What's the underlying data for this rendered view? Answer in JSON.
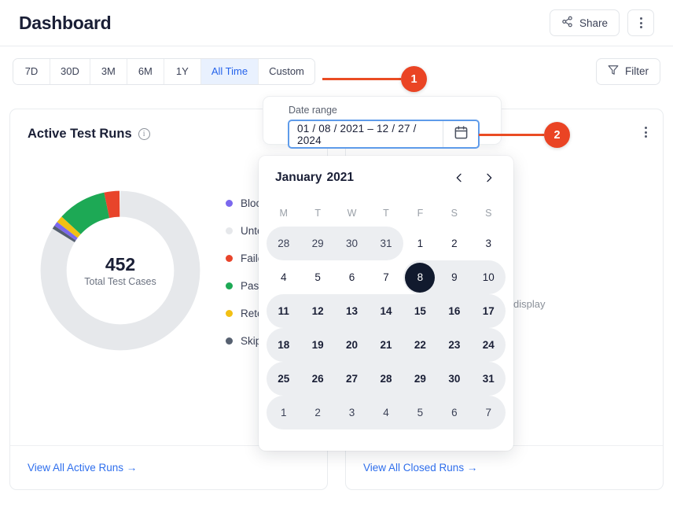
{
  "header": {
    "title": "Dashboard",
    "share_label": "Share",
    "share_icon": "share-icon",
    "more_icon": "kebab-menu-icon"
  },
  "toolbar": {
    "ranges": [
      {
        "label": "7D",
        "active": false
      },
      {
        "label": "30D",
        "active": false
      },
      {
        "label": "3M",
        "active": false
      },
      {
        "label": "6M",
        "active": false
      },
      {
        "label": "1Y",
        "active": false
      },
      {
        "label": "All Time",
        "active": true
      },
      {
        "label": "Custom",
        "active": false
      }
    ],
    "filter_label": "Filter",
    "filter_icon": "funnel-icon"
  },
  "callouts": [
    {
      "number": "1"
    },
    {
      "number": "2"
    }
  ],
  "active_card": {
    "title": "Active Test Runs",
    "info_icon": "info-icon",
    "total_value": "452",
    "total_label": "Total Test Cases",
    "footer_link": "View All Active Runs  →",
    "legend": [
      {
        "label": "Blocked",
        "color": "#7b68ee"
      },
      {
        "label": "Untested",
        "color": "#e6e8eb"
      },
      {
        "label": "Failed",
        "color": "#e8442b"
      },
      {
        "label": "Passed",
        "color": "#1da955"
      },
      {
        "label": "Retest",
        "color": "#f2c014"
      },
      {
        "label": "Skipped",
        "color": "#566070"
      }
    ]
  },
  "closed_card": {
    "empty_text": "No data to display",
    "footer_link": "View All Closed Runs  →",
    "more_icon": "kebab-menu-icon"
  },
  "date_range": {
    "label": "Date range",
    "value": "01 / 08 / 2021  –  12 / 27 / 2024",
    "calendar_icon": "calendar-icon"
  },
  "calendar": {
    "month": "January",
    "year": "2021",
    "prev_icon": "chevron-left-icon",
    "next_icon": "chevron-right-icon",
    "dow": [
      "M",
      "T",
      "W",
      "T",
      "F",
      "S",
      "S"
    ],
    "weeks": [
      [
        {
          "d": "28",
          "outside": true,
          "inrange": true,
          "rstart": true
        },
        {
          "d": "29",
          "outside": true,
          "inrange": true
        },
        {
          "d": "30",
          "outside": true,
          "inrange": true
        },
        {
          "d": "31",
          "outside": true,
          "inrange": true,
          "rend": true
        },
        {
          "d": "1",
          "outside": false
        },
        {
          "d": "2",
          "outside": false
        },
        {
          "d": "3",
          "outside": false
        }
      ],
      [
        {
          "d": "4",
          "outside": false
        },
        {
          "d": "5",
          "outside": false
        },
        {
          "d": "6",
          "outside": false
        },
        {
          "d": "7",
          "outside": false
        },
        {
          "d": "8",
          "outside": false,
          "inrange": true,
          "selected": true,
          "rstart": true
        },
        {
          "d": "9",
          "outside": false,
          "inrange": true
        },
        {
          "d": "10",
          "outside": false,
          "inrange": true,
          "rend": true
        }
      ],
      [
        {
          "d": "11",
          "outside": false,
          "inrange": true,
          "bold": true,
          "rstart": true
        },
        {
          "d": "12",
          "outside": false,
          "inrange": true,
          "bold": true
        },
        {
          "d": "13",
          "outside": false,
          "inrange": true,
          "bold": true
        },
        {
          "d": "14",
          "outside": false,
          "inrange": true,
          "bold": true
        },
        {
          "d": "15",
          "outside": false,
          "inrange": true,
          "bold": true
        },
        {
          "d": "16",
          "outside": false,
          "inrange": true,
          "bold": true
        },
        {
          "d": "17",
          "outside": false,
          "inrange": true,
          "bold": true,
          "rend": true
        }
      ],
      [
        {
          "d": "18",
          "outside": false,
          "inrange": true,
          "bold": true,
          "rstart": true
        },
        {
          "d": "19",
          "outside": false,
          "inrange": true,
          "bold": true
        },
        {
          "d": "20",
          "outside": false,
          "inrange": true,
          "bold": true
        },
        {
          "d": "21",
          "outside": false,
          "inrange": true,
          "bold": true
        },
        {
          "d": "22",
          "outside": false,
          "inrange": true,
          "bold": true
        },
        {
          "d": "23",
          "outside": false,
          "inrange": true,
          "bold": true
        },
        {
          "d": "24",
          "outside": false,
          "inrange": true,
          "bold": true,
          "rend": true
        }
      ],
      [
        {
          "d": "25",
          "outside": false,
          "inrange": true,
          "bold": true,
          "rstart": true
        },
        {
          "d": "26",
          "outside": false,
          "inrange": true,
          "bold": true
        },
        {
          "d": "27",
          "outside": false,
          "inrange": true,
          "bold": true
        },
        {
          "d": "28",
          "outside": false,
          "inrange": true,
          "bold": true
        },
        {
          "d": "29",
          "outside": false,
          "inrange": true,
          "bold": true
        },
        {
          "d": "30",
          "outside": false,
          "inrange": true,
          "bold": true
        },
        {
          "d": "31",
          "outside": false,
          "inrange": true,
          "bold": true,
          "rend": true
        }
      ],
      [
        {
          "d": "1",
          "outside": true,
          "inrange": true,
          "rstart": true
        },
        {
          "d": "2",
          "outside": true,
          "inrange": true
        },
        {
          "d": "3",
          "outside": true,
          "inrange": true
        },
        {
          "d": "4",
          "outside": true,
          "inrange": true
        },
        {
          "d": "5",
          "outside": true,
          "inrange": true
        },
        {
          "d": "6",
          "outside": true,
          "inrange": true
        },
        {
          "d": "7",
          "outside": true,
          "inrange": true,
          "rend": true
        }
      ]
    ]
  },
  "chart_data": {
    "type": "pie",
    "title": "Active Test Runs",
    "center_value": 452,
    "center_label": "Total Test Cases",
    "legend_position": "right",
    "categories": [
      "Blocked",
      "Untested",
      "Failed",
      "Passed",
      "Retest",
      "Skipped"
    ],
    "values": [
      4,
      380,
      14,
      45,
      6,
      3
    ],
    "colors": [
      "#7b68ee",
      "#e6e8eb",
      "#e8442b",
      "#1da955",
      "#f2c014",
      "#566070"
    ]
  }
}
